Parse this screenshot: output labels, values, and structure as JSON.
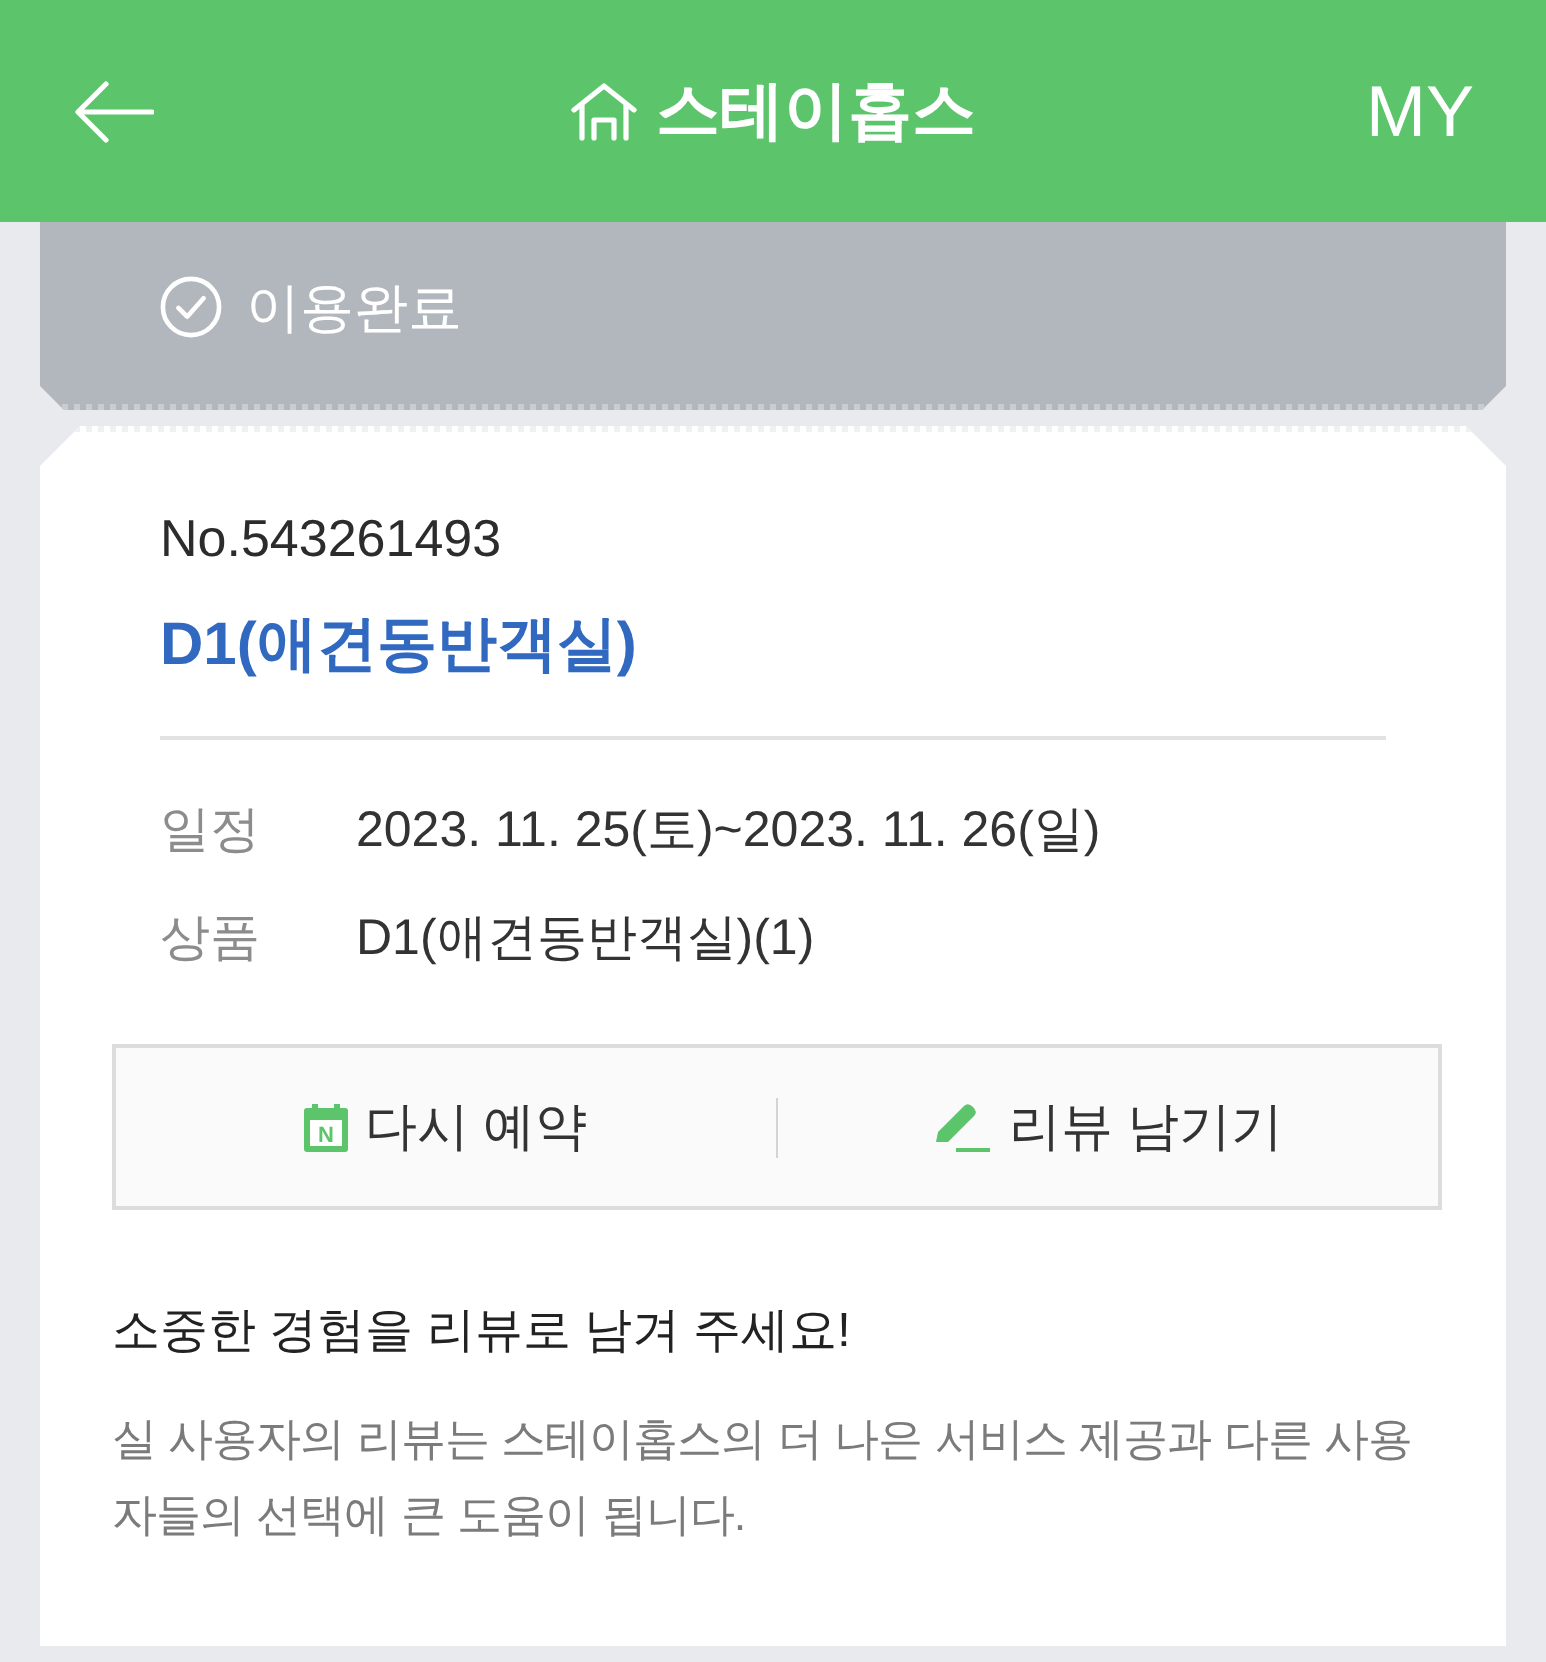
{
  "header": {
    "title": "스테이홉스",
    "right_link": "MY"
  },
  "status": {
    "label": "이용완료"
  },
  "booking": {
    "number": "No.543261493",
    "room_name": "D1(애견동반객실)",
    "details": [
      {
        "label": "일정",
        "value": "2023. 11. 25(토)~2023. 11. 26(일)"
      },
      {
        "label": "상품",
        "value": "D1(애견동반객실)(1)"
      }
    ]
  },
  "actions": [
    {
      "kind": "rebook",
      "label": "다시 예약",
      "icon_letter": "N"
    },
    {
      "kind": "review",
      "label": "리뷰 남기기"
    }
  ],
  "review_prompt": {
    "title": "소중한 경험을 리뷰로 남겨 주세요!",
    "description": "실 사용자의 리뷰는 스테이홉스의 더 나은 서비스 제공과 다른 사용자들의 선택에 큰 도움이 됩니다."
  }
}
